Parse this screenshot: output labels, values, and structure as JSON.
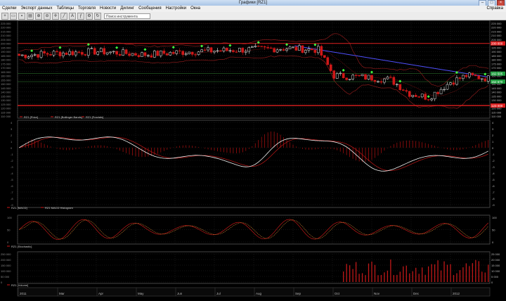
{
  "window": {
    "title": "Графики [RZ1]"
  },
  "menu": {
    "items": [
      "Сделки",
      "Экспорт данных",
      "Таблицы",
      "Торговля",
      "Новости",
      "Дилинг",
      "Сообщения",
      "Настройки",
      "Окна"
    ],
    "right_label": "Справка"
  },
  "toolbar": {
    "search_placeholder": "Поиск инструмента"
  },
  "price_axis_ticks": [
    "225 000",
    "220 000",
    "215 000",
    "210 000",
    "205 000",
    "200 000",
    "195 000",
    "190 000",
    "185 000",
    "180 000",
    "175 000",
    "170 000",
    "165 000",
    "160 000",
    "155 000",
    "150 000",
    "145 000",
    "140 000",
    "135 000",
    "130 000",
    "125 000",
    "120 000",
    "115 000",
    "110 000"
  ],
  "price_tags": [
    {
      "label": "200 000",
      "color": "#e02020"
    },
    {
      "label": "162 505",
      "color": "#20a040"
    },
    {
      "label": "152 670",
      "color": "#20a040"
    },
    {
      "label": "123 000",
      "color": "#e02020"
    }
  ],
  "panel_legends": {
    "price": [
      "RZ1 [Price]",
      "RZ1 [Bollinger Bands]",
      "RZ1 [Fractals]"
    ],
    "macd": [
      "RZ1 [MACD]",
      "RZ1 MACD Histogram"
    ],
    "stoch": [
      "RZ1 [Stochastic]"
    ],
    "volume": [
      "RZ1 [Volume]"
    ]
  },
  "macd_axis_ticks": [
    "4",
    "3",
    "2",
    "1",
    "0",
    "-1",
    "-2",
    "-3",
    "-4",
    "-5",
    "-6",
    "-7",
    "-8",
    "-9"
  ],
  "stoch_axis_ticks": [
    "100",
    "50",
    "0"
  ],
  "volume_axis_ticks_left": [
    "250 000",
    "200 000",
    "150 000",
    "100 000",
    "50 000",
    "0"
  ],
  "volume_axis_ticks_right": [
    "25 000",
    "20 000",
    "15 000",
    "10 000",
    "5 000",
    "0"
  ],
  "date_labels": [
    "2011",
    "Mar",
    "Apr",
    "May",
    "Jun",
    "Jul",
    "Aug",
    "Sep",
    "Oct",
    "Nov",
    "Dec",
    "2012"
  ],
  "colors": {
    "bull": "#e8e8e8",
    "bear": "#d01818",
    "fractal": "#40ff40",
    "trendline": "#5050ff",
    "grid": "#2a2a2a"
  }
}
